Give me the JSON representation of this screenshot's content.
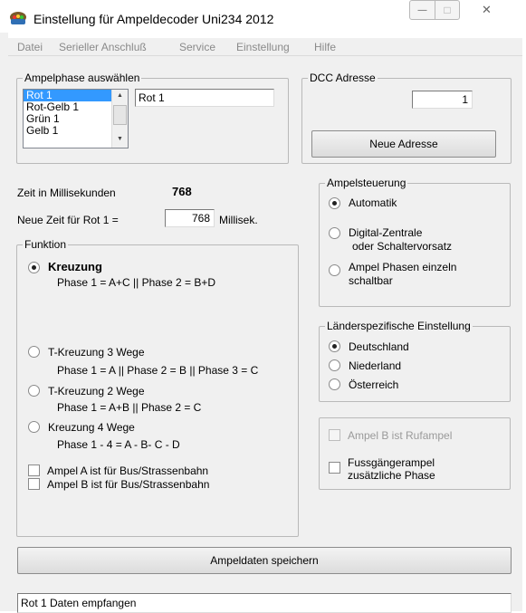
{
  "window": {
    "title": "Einstellung für Ampeldecoder Uni234 2012",
    "min_glyph": "—",
    "max_glyph": "□",
    "close_glyph": "✕"
  },
  "menu": [
    "Datei",
    "Serieller Anschluß",
    "Service",
    "Einstellung",
    "Hilfe"
  ],
  "ampelphase": {
    "title": "Ampelphase auswählen",
    "items": [
      "Rot 1",
      "Rot-Gelb 1",
      "Grün 1",
      "Gelb 1"
    ],
    "selected_value": "Rot 1"
  },
  "dcc": {
    "title": "DCC Adresse",
    "value": "1",
    "button": "Neue Adresse"
  },
  "time": {
    "label": "Zeit in Millisekunden",
    "value": "768",
    "new_label": "Neue Zeit für Rot 1 =",
    "new_value": "768",
    "unit": "Millisek."
  },
  "funktion": {
    "title": "Funktion",
    "options": [
      {
        "label": "Kreuzung",
        "detail": "Phase 1 = A+C || Phase 2 =  B+D",
        "checked": true
      },
      {
        "label": "T-Kreuzung 3 Wege",
        "detail": "Phase 1 = A || Phase 2 = B || Phase 3 = C",
        "checked": false
      },
      {
        "label": "T-Kreuzung 2 Wege",
        "detail": "Phase 1 = A+B || Phase 2 = C",
        "checked": false
      },
      {
        "label": "Kreuzung 4 Wege",
        "detail": "Phase 1 - 4 = A - B- C - D",
        "checked": false
      }
    ],
    "checkboxes": [
      "Ampel A ist für Bus/Strassenbahn",
      "Ampel B ist für Bus/Strassenbahn"
    ]
  },
  "ampelsteuerung": {
    "title": "Ampelsteuerung",
    "options": [
      "Automatik",
      "Digital-Zentrale",
      "oder Schaltervorsatz",
      "Ampel Phasen einzeln",
      "schaltbar"
    ],
    "selected": "Automatik"
  },
  "laender": {
    "title": "Länderspezifische Einstellung",
    "options": [
      "Deutschland",
      "Niederland",
      "Österreich"
    ],
    "selected": "Deutschland"
  },
  "extra": {
    "rufampel": "Ampel B ist Rufampel",
    "fussgaenger_line1": "Fussgängerampel",
    "fussgaenger_line2": "zusätzliche Phase"
  },
  "save_button": "Ampeldaten speichern",
  "status": "Rot 1 Daten empfangen"
}
